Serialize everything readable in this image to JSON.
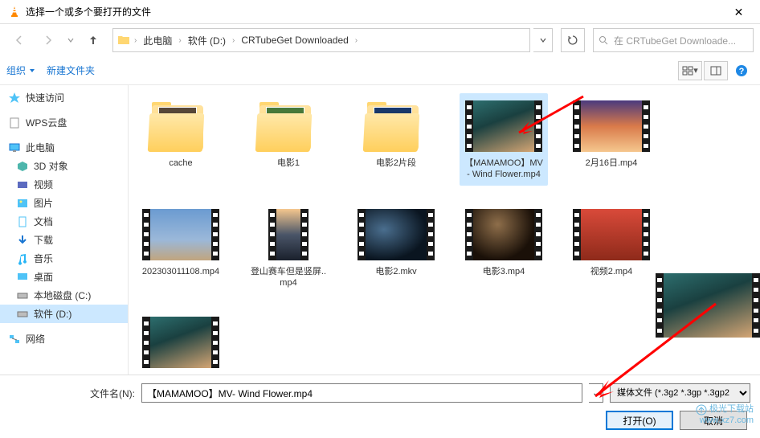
{
  "title": "选择一个或多个要打开的文件",
  "breadcrumbs": [
    "此电脑",
    "软件 (D:)",
    "CRTubeGet Downloaded"
  ],
  "search_placeholder": "在 CRTubeGet Downloade...",
  "toolbar": {
    "organize": "组织",
    "new_folder": "新建文件夹"
  },
  "sidebar": {
    "quick_access": "快速访问",
    "wps": "WPS云盘",
    "this_pc": "此电脑",
    "sub": {
      "obj3d": "3D 对象",
      "video": "视频",
      "pic": "图片",
      "doc": "文档",
      "dl": "下载",
      "music": "音乐",
      "desktop": "桌面",
      "cdrive": "本地磁盘 (C:)",
      "ddrive": "软件 (D:)"
    },
    "network": "网络"
  },
  "files": {
    "row1": [
      {
        "name": "cache",
        "type": "folder",
        "img": "grad-dark"
      },
      {
        "name": "电影1",
        "type": "folder",
        "img": "grad-green"
      },
      {
        "name": "电影2片段",
        "type": "folder",
        "img": "grad-blue"
      },
      {
        "name": "【MAMAMOO】MV- Wind Flower.mp4",
        "type": "video",
        "img": "grad-tealroom",
        "sel": true
      },
      {
        "name": "2月16日.mp4",
        "type": "video",
        "img": "grad-sunset"
      }
    ],
    "row2": [
      {
        "name": "202303011108.mp4",
        "type": "video",
        "img": "grad-sky"
      },
      {
        "name": "登山赛车但是竖屏..mp4",
        "type": "video",
        "img": "grad-orange",
        "narrow": true
      },
      {
        "name": "电影2.mkv",
        "type": "video",
        "img": "grad-space1"
      },
      {
        "name": "电影3.mp4",
        "type": "video",
        "img": "grad-space2"
      },
      {
        "name": "视频2.mp4",
        "type": "video",
        "img": "grad-red"
      }
    ]
  },
  "bottom": {
    "filename_label": "文件名(N):",
    "filename_value": "【MAMAMOO】MV- Wind Flower.mp4",
    "filter": "媒体文件 (*.3g2 *.3gp *.3gp2",
    "open": "打开(O)",
    "cancel": "取消"
  },
  "watermark": {
    "name": "极光下载站",
    "url": "www.xz7.com"
  }
}
